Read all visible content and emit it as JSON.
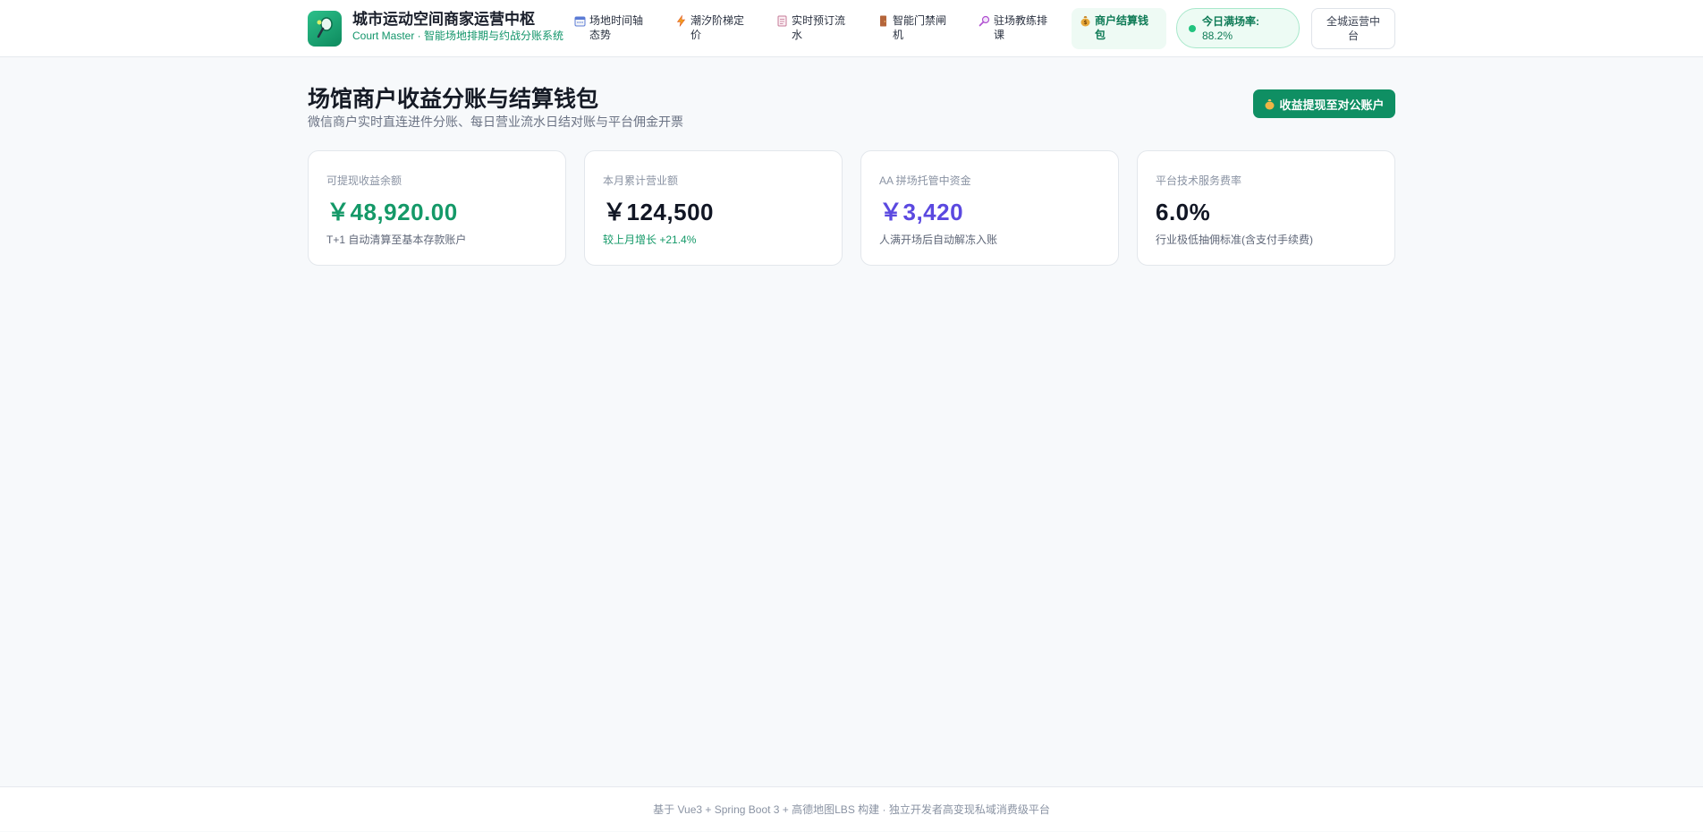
{
  "brand": {
    "title": "城市运动空间商家运营中枢",
    "subtitle": "Court Master · 智能场地排期与约战分账系统"
  },
  "nav": {
    "items": [
      {
        "label": "场地时间轴态势",
        "icon": "calendar-icon"
      },
      {
        "label": "潮汐阶梯定价",
        "icon": "lightning-icon"
      },
      {
        "label": "实时预订流水",
        "icon": "memo-icon"
      },
      {
        "label": "智能门禁闸机",
        "icon": "door-icon"
      },
      {
        "label": "驻场教练排课",
        "icon": "whistle-icon"
      },
      {
        "label": "商户结算钱包",
        "icon": "money-bag-icon",
        "active": true
      }
    ]
  },
  "status": {
    "rate_label": "今日满场率:",
    "rate_value": "88.2%"
  },
  "city_button": "全城运营中台",
  "page": {
    "title": "场馆商户收益分账与结算钱包",
    "subtitle": "微信商户实时直连进件分账、每日营业流水日结对账与平台佣金开票",
    "withdraw_label": "收益提现至对公账户"
  },
  "cards": [
    {
      "label": "可提现收益余额",
      "value": "￥48,920.00",
      "note": "T+1 自动清算至基本存款账户"
    },
    {
      "label": "本月累计营业额",
      "value": "￥124,500",
      "note": "较上月增长 +21.4%"
    },
    {
      "label": "AA 拼场托管中资金",
      "value": "￥3,420",
      "note": "人满开场后自动解冻入账"
    },
    {
      "label": "平台技术服务费率",
      "value": "6.0%",
      "note": "行业极低抽佣标准(含支付手续费)"
    }
  ],
  "colors": {
    "accent": "#0f8f63",
    "accent_light": "#edfbf4",
    "purple": "#5b49e0"
  },
  "footer": "基于 Vue3 + Spring Boot 3 + 高德地图LBS 构建 · 独立开发者高变现私域消费级平台"
}
